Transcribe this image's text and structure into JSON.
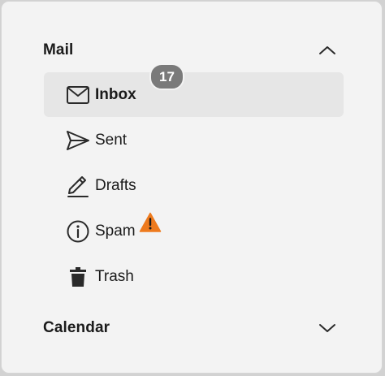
{
  "sections": {
    "mail": {
      "title": "Mail",
      "expanded": true,
      "chevron_icon": "chevron-up-icon"
    },
    "calendar": {
      "title": "Calendar",
      "expanded": false,
      "chevron_icon": "chevron-down-icon"
    }
  },
  "mail_items": [
    {
      "label": "Inbox",
      "icon": "mail-envelope-icon",
      "selected": true,
      "badge": "17"
    },
    {
      "label": "Sent",
      "icon": "send-arrow-icon",
      "selected": false
    },
    {
      "label": "Drafts",
      "icon": "pencil-icon",
      "selected": false
    },
    {
      "label": "Spam",
      "icon": "info-circle-icon",
      "selected": false,
      "alert_icon": "warning-triangle-icon"
    },
    {
      "label": "Trash",
      "icon": "trash-icon",
      "selected": false
    }
  ],
  "colors": {
    "selected_background": "#e6e6e6",
    "badge_background": "#7a7a7a",
    "warning": "#ee7a1d",
    "text": "#1b1b1b"
  }
}
